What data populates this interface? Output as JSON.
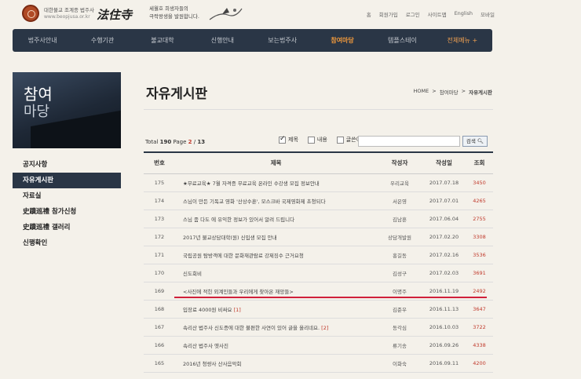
{
  "header": {
    "logo_sub": "대한불교 조계종 법주사",
    "logo_url": "www.beopjusa.or.kr",
    "logo_name": "法住寺",
    "slogan_line1": "세월호 희생자들의",
    "slogan_line2": "극락왕생을 발원합니다.",
    "top_links": [
      "홈",
      "회원가입",
      "로그인",
      "사이트맵",
      "English",
      "모바일"
    ]
  },
  "nav": {
    "items": [
      "법주사안내",
      "수행기관",
      "불교대학",
      "신행안내",
      "보는법주사",
      "참여마당",
      "템플스테이",
      "전체메뉴 +"
    ],
    "active_index": 5
  },
  "sidebar": {
    "banner_line1": "참여",
    "banner_line2": "마당",
    "items": [
      "공지사항",
      "자유게시판",
      "자료실",
      "史蹟巡禮 참가신청",
      "史蹟巡禮 갤러리",
      "신행확인"
    ],
    "active_index": 1
  },
  "page": {
    "title": "자유게시판",
    "breadcrumb": [
      "HOME",
      ">",
      "참여마당",
      ">",
      "자유게시판"
    ]
  },
  "board": {
    "total_label": "Total",
    "total": "190",
    "page_label": "Page",
    "page_current": "2",
    "page_sep": "/",
    "page_total": "13",
    "filters": [
      {
        "label": "제목",
        "checked": true
      },
      {
        "label": "내용",
        "checked": false
      },
      {
        "label": "글쓴이",
        "checked": false
      }
    ],
    "search_value": "",
    "search_button": "검색",
    "columns": [
      "번호",
      "제목",
      "작성자",
      "작성일",
      "조회"
    ],
    "rows": [
      {
        "no": "175",
        "title": "★무료교육★ 7월 자격증 무료교육 온라인 수강생 모집 정보안내",
        "comments": "",
        "author": "우리교육",
        "date": "2017.07.18",
        "views": "3450"
      },
      {
        "no": "174",
        "title": "스님이 만든 기독교 영화 '산상수훈', 모스크바 국제영화제 초청되다",
        "comments": "",
        "author": "서은영",
        "date": "2017.07.01",
        "views": "4265"
      },
      {
        "no": "173",
        "title": "스님 좀 다도 에 유익한 정보가 있어서 알려 드립니다",
        "comments": "",
        "author": "김남훈",
        "date": "2017.06.04",
        "views": "2755"
      },
      {
        "no": "172",
        "title": "2017년 불교상담대학(원) 신입생 모집 안내",
        "comments": "",
        "author": "상담개발원",
        "date": "2017.02.20",
        "views": "3308"
      },
      {
        "no": "171",
        "title": "국립공원 탐방객에 대한 문화재관람료 강제징수 근거요청",
        "comments": "",
        "author": "홍길동",
        "date": "2017.02.16",
        "views": "3536"
      },
      {
        "no": "170",
        "title": "신도회비",
        "comments": "",
        "author": "김성구",
        "date": "2017.02.03",
        "views": "3691"
      },
      {
        "no": "169",
        "title": "<사진에 적힌 외계인들과 우리에게 찾아온 재앙들>",
        "comments": "",
        "author": "이명주",
        "date": "2016.11.19",
        "views": "2492"
      },
      {
        "no": "168",
        "title": "입장료 4000원 비싸요",
        "comments": "[1]",
        "author": "김준우",
        "date": "2016.11.13",
        "views": "3647"
      },
      {
        "no": "167",
        "title": "속리산 법주사 신도증에 대한 불편한 사연이 있어 글을 올리네요.",
        "comments": "[2]",
        "author": "동각심",
        "date": "2016.10.03",
        "views": "3722"
      },
      {
        "no": "166",
        "title": "속리산 법주사 옛사진",
        "comments": "",
        "author": "류기송",
        "date": "2016.09.26",
        "views": "4338"
      },
      {
        "no": "165",
        "title": "2016년 청량사 산사음악회",
        "comments": "",
        "author": "이화숙",
        "date": "2016.09.11",
        "views": "4200"
      }
    ]
  },
  "colors": {
    "nav_bg": "#2a3646",
    "accent_orange": "#f29a3c",
    "accent_red": "#c0392b",
    "highlight_line": "#d0203a"
  }
}
